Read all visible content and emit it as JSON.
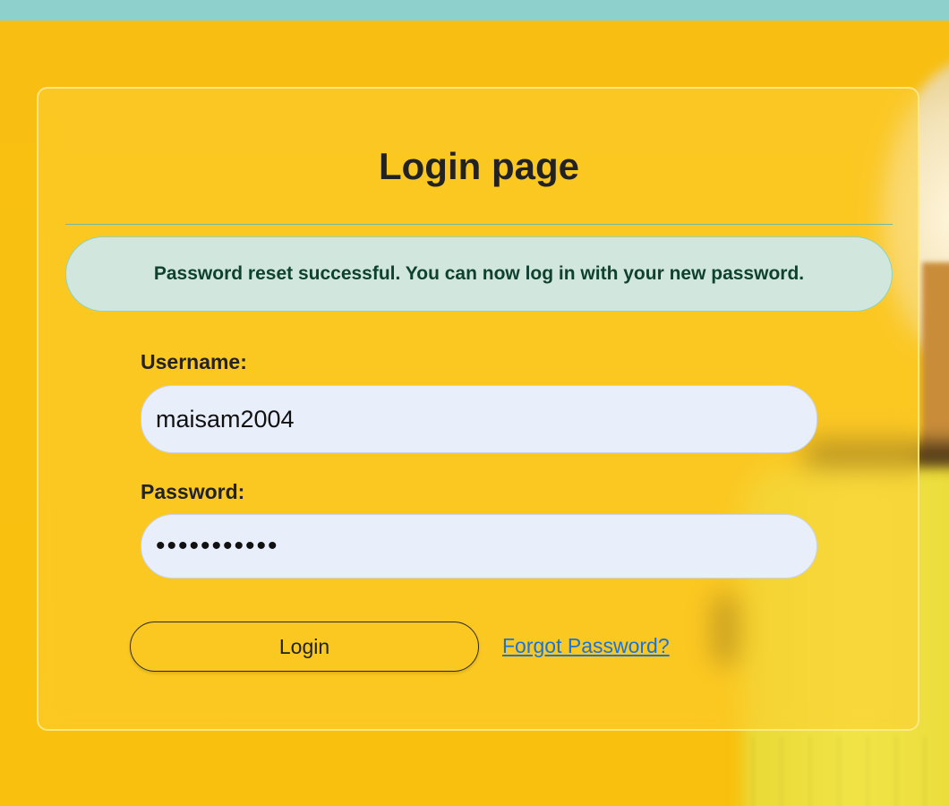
{
  "page": {
    "title": "Login page"
  },
  "alert": {
    "message": "Password reset successful. You can now log in with your new password."
  },
  "form": {
    "username_label": "Username:",
    "username_value": "maisam2004",
    "password_label": "Password:",
    "password_value": "maisam20040",
    "login_label": "Login",
    "forgot_label": "Forgot Password?"
  },
  "colors": {
    "accent_strip": "#8dd0cc",
    "background": "#f9bd0b",
    "alert_bg": "#d1e7dd",
    "alert_text": "#0f4131",
    "input_bg": "#e8effb",
    "link": "#1a73d9"
  }
}
